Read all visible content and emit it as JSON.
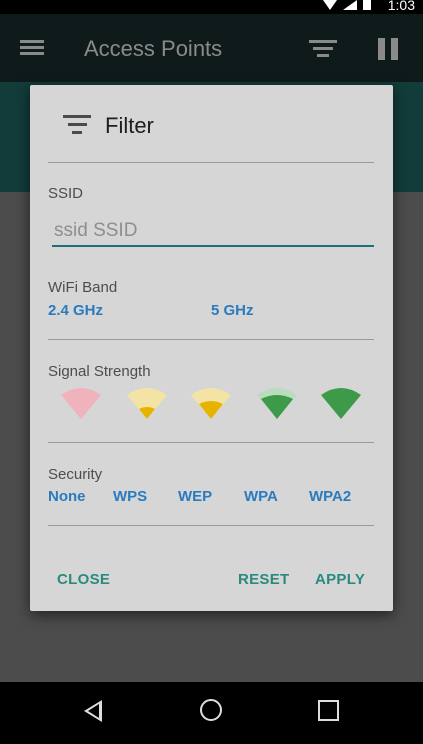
{
  "status_bar": {
    "time": "1:03"
  },
  "app_bar": {
    "title": "Access Points",
    "menu_icon": "menu-icon",
    "filter_icon": "filter-icon",
    "pause_icon": "pause-icon"
  },
  "dialog": {
    "title": "Filter",
    "ssid": {
      "label": "SSID",
      "placeholder": "ssid SSID",
      "value": ""
    },
    "wifi_band": {
      "label": "WiFi Band",
      "options": [
        "2.4 GHz",
        "5 GHz"
      ]
    },
    "signal_strength": {
      "label": "Signal Strength",
      "levels": [
        {
          "level": 0,
          "icon": "wifi-signal-0-icon",
          "color": "#f0b3bd"
        },
        {
          "level": 1,
          "icon": "wifi-signal-1-icon",
          "color": "#e6b400"
        },
        {
          "level": 2,
          "icon": "wifi-signal-2-icon",
          "color": "#e6b400"
        },
        {
          "level": 3,
          "icon": "wifi-signal-3-icon",
          "color": "#3c9a48"
        },
        {
          "level": 4,
          "icon": "wifi-signal-4-icon",
          "color": "#3c9a48"
        }
      ]
    },
    "security": {
      "label": "Security",
      "options": [
        "None",
        "WPS",
        "WEP",
        "WPA",
        "WPA2"
      ]
    },
    "actions": {
      "close": "CLOSE",
      "reset": "RESET",
      "apply": "APPLY"
    }
  },
  "colors": {
    "accent": "#2a7bc0",
    "action": "#2a8a7d",
    "input_underline": "#1f6f7a"
  }
}
